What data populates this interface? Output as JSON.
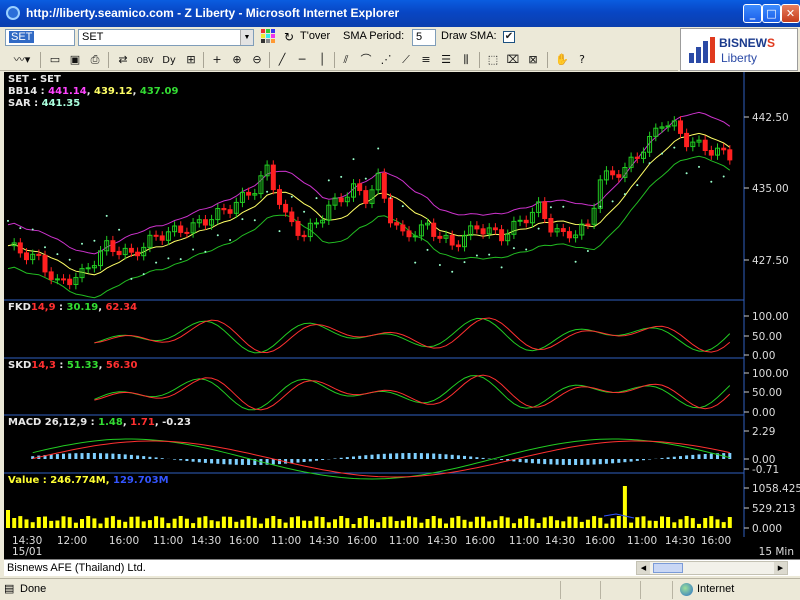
{
  "window": {
    "title": "http://liberty.seamico.com - Z Liberty - Microsoft Internet Explorer",
    "buttons": {
      "minimize": "_",
      "maximize": "□",
      "close": "✕"
    }
  },
  "toolbar": {
    "symbol_value": "SET",
    "symbol_dropdown_value": "SET",
    "tover_label": "T'over",
    "sma_period_label": "SMA Period:",
    "sma_period_value": "5",
    "draw_sma_label": "Draw SMA:",
    "draw_sma_checked": "✔"
  },
  "logo": {
    "brand_main": "BISNEW",
    "brand_accent": "S",
    "sub": "Liberty"
  },
  "chart": {
    "main_legend": {
      "series_line": "SET - SET",
      "bb_label": "BB14 : ",
      "bb_upper": "441.14",
      "bb_mid": "439.12",
      "bb_lower": "437.09",
      "sar_label": "SAR : ",
      "sar_value": "441.35"
    },
    "fkd_legend": {
      "name": "FKD",
      "params": "14,9",
      "sep": " : ",
      "k": "30.19",
      "d": "62.34"
    },
    "skd_legend": {
      "name": "SKD",
      "params": "14,3",
      "sep": " : ",
      "k": "51.33",
      "d": "56.30"
    },
    "macd_legend": {
      "name": "MACD 26,12,9 : ",
      "macd": "1.48",
      "signal": "1.71",
      "hist": "-0.23"
    },
    "value_legend": {
      "name": "Value : ",
      "value": "246.774M",
      "ma": "129.703M"
    },
    "price_ticks": [
      "442.50",
      "435.00",
      "427.50"
    ],
    "fkd_ticks": [
      "100.00",
      "50.00",
      "0.00"
    ],
    "skd_ticks": [
      "100.00",
      "50.00",
      "0.00"
    ],
    "macd_ticks": [
      "2.29",
      "0.00",
      "-0.71"
    ],
    "value_ticks": [
      "1058.425",
      "529.213",
      "0.000"
    ],
    "time_labels": [
      "12:00",
      "16:00",
      "11:00",
      "14:30",
      "16:00",
      "11:00",
      "14:30",
      "16:00",
      "11:00",
      "14:30",
      "16:00",
      "11:00",
      "14:30",
      "16:00",
      "11:00",
      "14:30",
      "16:00"
    ],
    "date_label_time": "14:30",
    "date_label": "15/01",
    "interval": "15 Min",
    "colors": {
      "up": "#22cc22",
      "down": "#ff2020",
      "bb_band": "#cc33cc",
      "bb_mid": "#ffff66",
      "bb_low": "#22bb22",
      "sar": "#99ffcc",
      "k_line": "#22cc22",
      "d_line": "#ff3030",
      "hist": "#7fd0ff",
      "volume": "#ffff00",
      "grid": "#3060c0"
    }
  },
  "info_strip": {
    "text": "Bisnews AFE (Thailand) Ltd."
  },
  "statusbar": {
    "status": "Done",
    "zone": "Internet"
  }
}
